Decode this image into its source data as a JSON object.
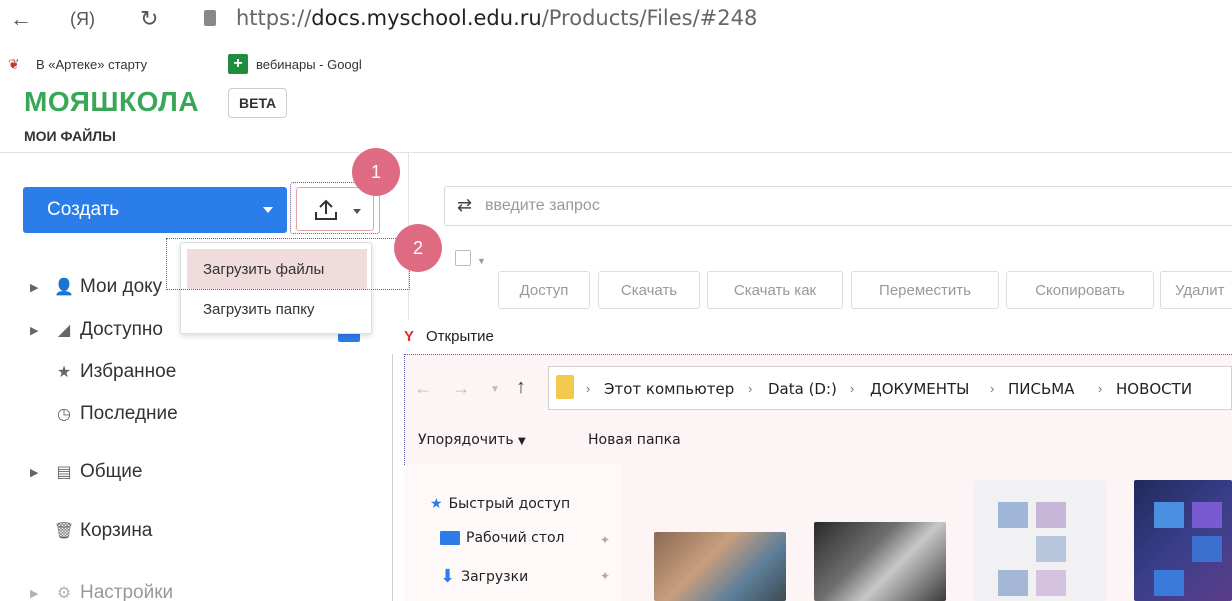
{
  "browser": {
    "back_glyph": "←",
    "yandex_glyph": "(Я)",
    "reload_glyph": "↻",
    "url_scheme": "https://",
    "url_host": "docs.myschool.edu.ru",
    "url_path": "/Products/Files/#248"
  },
  "bookmarks": [
    {
      "label": "В «Артеке» старту"
    },
    {
      "label": "вебинары - Googl"
    }
  ],
  "app": {
    "logo": "МОЯШКОЛА",
    "beta": "BETA",
    "page_title": "МОИ ФАЙЛЫ"
  },
  "toolbar": {
    "create_label": "Создать",
    "search_placeholder": "введите запрос",
    "buttons": [
      "Доступ",
      "Скачать",
      "Скачать как",
      "Переместить",
      "Скопировать",
      "Удалит"
    ]
  },
  "badges": [
    "1",
    "2"
  ],
  "upload_menu": {
    "items": [
      "Загрузить файлы",
      "Загрузить папку"
    ]
  },
  "sidebar": {
    "items": [
      {
        "label": "Мои доку",
        "icon": "user-icon",
        "glyph": "👤"
      },
      {
        "label": "Доступно",
        "icon": "shared-icon",
        "glyph": "◢"
      },
      {
        "label": "Избранное",
        "icon": "star-icon",
        "glyph": "★"
      },
      {
        "label": "Последние",
        "icon": "clock-icon",
        "glyph": "◷"
      },
      {
        "label": "Общие",
        "icon": "briefcase-icon",
        "glyph": "▤"
      },
      {
        "label": "Корзина",
        "icon": "trash-icon",
        "glyph": "🗑"
      },
      {
        "label": "Настройки",
        "icon": "gear-icon",
        "glyph": "⚙"
      }
    ]
  },
  "dialog": {
    "title": "Открытие",
    "breadcrumbs": [
      "Этот компьютер",
      "Data (D:)",
      "ДОКУМЕНТЫ",
      "ПИСЬМА",
      "НОВОСТИ"
    ],
    "commands": [
      "Упорядочить",
      "Новая папка"
    ],
    "tree": [
      {
        "label": "Быстрый доступ",
        "icon": "star-icon"
      },
      {
        "label": "Рабочий стол",
        "icon": "desktop-icon"
      },
      {
        "label": "Загрузки",
        "icon": "download-icon"
      }
    ]
  },
  "colors": {
    "accent": "#2b7de9",
    "logo": "#3aa757",
    "badge": "#de6b82",
    "highlight": "#f0dcdc"
  }
}
